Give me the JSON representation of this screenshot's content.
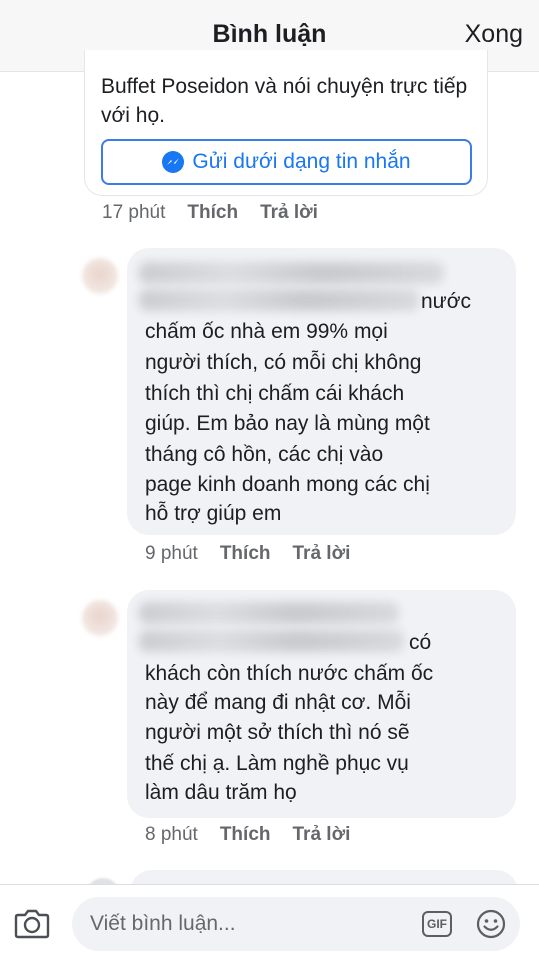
{
  "header": {
    "title": "Bình luận",
    "done": "Xong"
  },
  "card": {
    "text": "Buffet Poseidon và nói chuyện trực tiếp với họ.",
    "button_label": "Gửi dưới dạng tin nhắn",
    "button_icon": "messenger-icon",
    "time": "17 phút",
    "like": "Thích",
    "reply": "Trả lời"
  },
  "comments": [
    {
      "lines": [
        "nước",
        "chấm ốc nhà em 99% mọi",
        "người thích, có mỗi chị không",
        "thích thì chị chấm cái khách",
        "giúp. Em bảo nay là mùng một",
        "tháng cô hồn, các chị vào",
        "page kinh doanh mong các chị",
        "hỗ trợ giúp em"
      ],
      "time": "9 phút",
      "like": "Thích",
      "reply": "Trả lời"
    },
    {
      "lines": [
        "có",
        "khách còn thích nước chấm ốc",
        "này để mang đi nhật cơ. Mỗi",
        "người một sở thích thì nó sẽ",
        "thế chị ạ. Làm nghề phục vụ",
        "làm dâu trăm họ"
      ],
      "time": "8 phút",
      "like": "Thích",
      "reply": "Trả lời"
    }
  ],
  "composer": {
    "placeholder": "Viết bình luận...",
    "gif_label": "GIF",
    "camera_icon": "camera-icon",
    "emoji_icon": "smiley-icon"
  }
}
